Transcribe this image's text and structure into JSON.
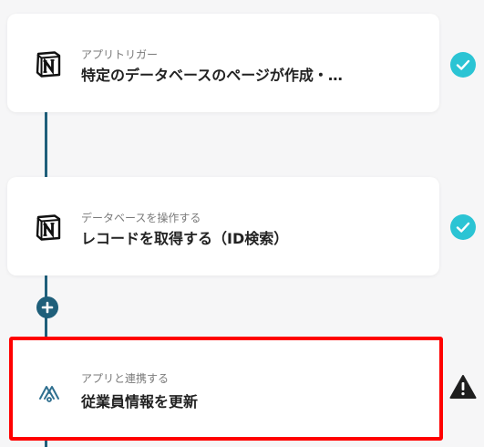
{
  "flow": {
    "steps": [
      {
        "subtitle": "アプリトリガー",
        "title": "特定のデータベースのページが作成・…",
        "app_icon": "notion-icon",
        "status_icon": "check-circle-icon",
        "status_color": "#2bc4d4"
      },
      {
        "subtitle": "データベースを操作する",
        "title": "レコードを取得する（ID検索）",
        "app_icon": "notion-icon",
        "status_icon": "check-circle-icon",
        "status_color": "#2bc4d4"
      },
      {
        "subtitle": "アプリと連携する",
        "title": "従業員情報を更新",
        "app_icon": "integration-app-icon",
        "status_icon": "warning-triangle-icon",
        "status_color": "#1f1f1f",
        "highlight_color": "#ff0000"
      }
    ],
    "add_button_icon": "plus-icon",
    "connector_color": "#1f5f7a"
  }
}
